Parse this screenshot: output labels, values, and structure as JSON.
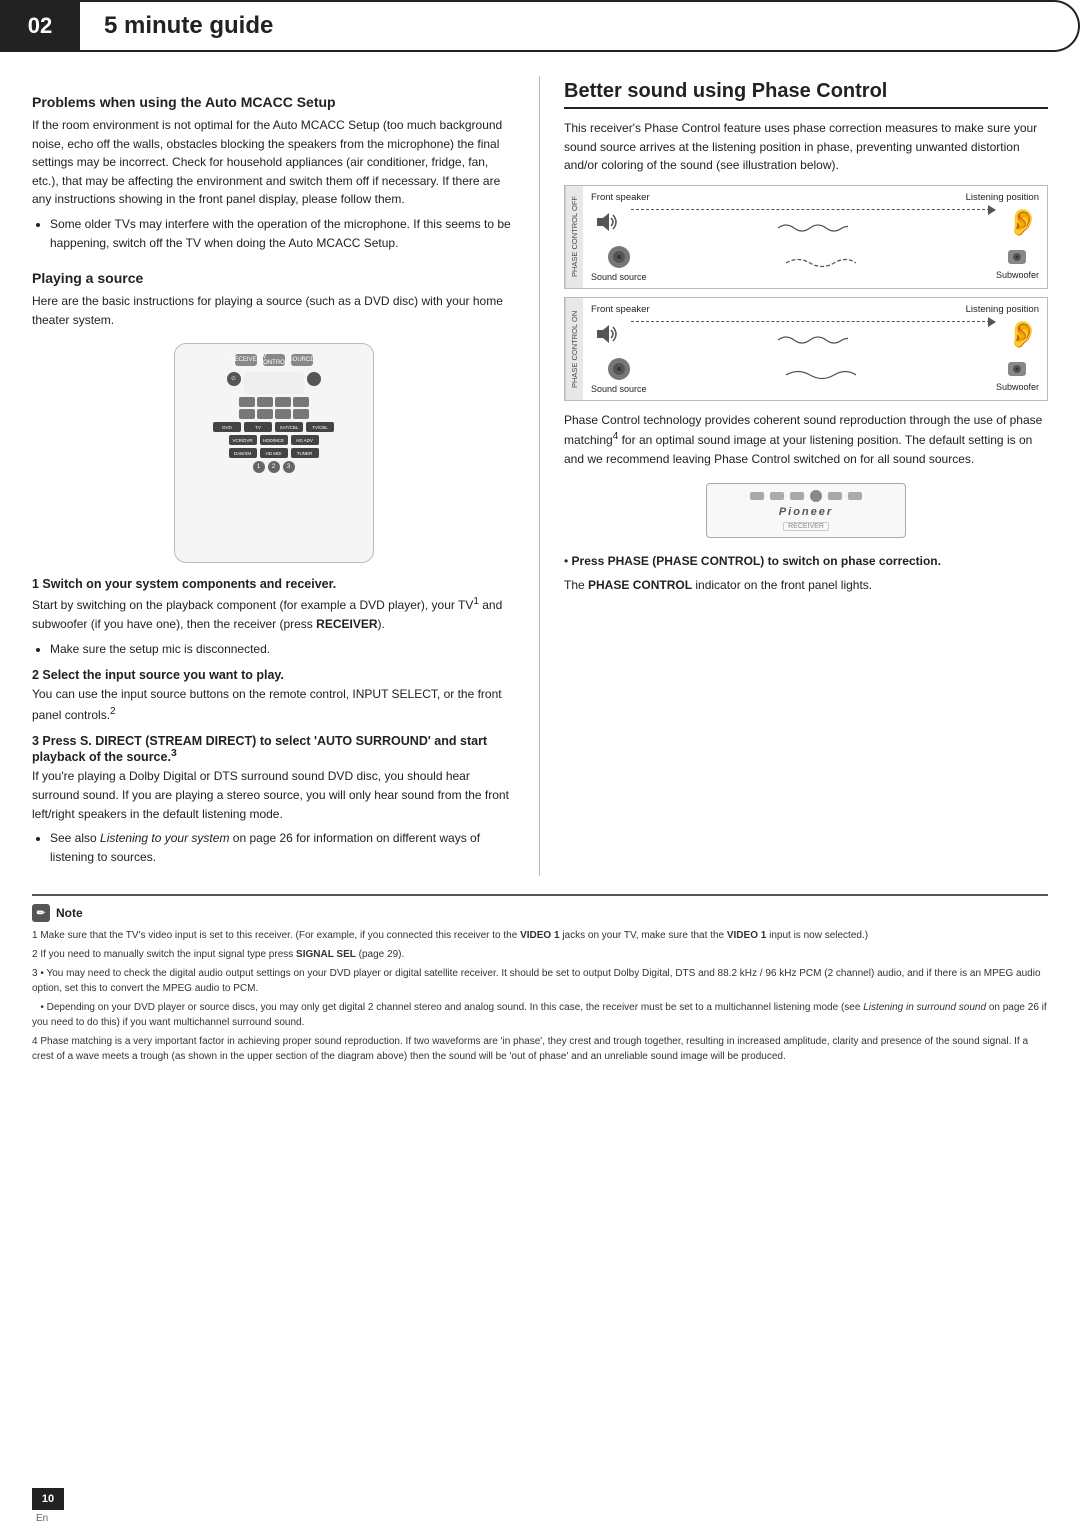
{
  "header": {
    "number": "02",
    "title": "5 minute guide"
  },
  "left_column": {
    "auto_mcacc_heading": "Problems when using the Auto MCACC Setup",
    "auto_mcacc_para1": "If the room environment is not optimal for the Auto MCACC Setup (too much background noise, echo off the walls, obstacles blocking the speakers from the microphone) the final settings may be incorrect. Check for household appliances (air conditioner, fridge, fan, etc.), that may be affecting the environment and switch them off if necessary. If there are any instructions showing in the front panel display, please follow them.",
    "auto_mcacc_bullet1": "Some older TVs may interfere with the operation of the microphone. If this seems to be happening, switch off the TV when doing the Auto MCACC Setup.",
    "playing_heading": "Playing a source",
    "playing_para": "Here are the basic instructions for playing a source (such as a DVD disc) with your home theater system.",
    "step1_title": "1   Switch on your system components and receiver.",
    "step1_para": "Start by switching on the playback component (for example a DVD player), your TV",
    "step1_super1": "1",
    "step1_para2": " and subwoofer (if you have one), then the receiver (press",
    "step1_receiver": " RECEIVER",
    "step1_para3": ").",
    "step1_bullet": "Make sure the setup mic is disconnected.",
    "step2_title": "2   Select the input source you want to play.",
    "step2_para": "You can use the input source buttons on the remote control, INPUT SELECT, or the front panel controls.",
    "step2_super": "2",
    "step3_title": "3   Press S. DIRECT (STREAM DIRECT) to select 'AUTO SURROUND' and start playback of the source.",
    "step3_super": "3",
    "step3_para": "If you're playing a Dolby Digital or DTS surround sound DVD disc, you should hear surround sound. If you are playing a stereo source, you will only hear sound from the front left/right speakers in the default listening mode.",
    "step3_bullet": "See also Listening to your system on page 26 for information on different ways of listening to sources."
  },
  "right_column": {
    "better_sound_heading": "Better sound using Phase Control",
    "better_sound_para1": "This receiver's Phase Control feature uses phase correction measures to make sure your sound source arrives at the listening position in phase, preventing unwanted distortion and/or coloring of the sound (see illustration below).",
    "diagram1_side_label": "PHASE CONTROL OFF",
    "diagram2_side_label": "PHASE CONTROL ON",
    "diagram_top_left1": "Front speaker",
    "diagram_top_right1": "Listening\nposition",
    "diagram_sound_source1": "Sound\nsource",
    "diagram_subwoofer1": "Subwoofer",
    "diagram_top_left2": "Front speaker",
    "diagram_top_right2": "Listening\nposition",
    "diagram_sound_source2": "Sound\nsource",
    "diagram_subwoofer2": "Subwoofer",
    "phase_para": "Phase Control technology provides coherent sound reproduction through the use of phase matching",
    "phase_super": "4",
    "phase_para2": " for an optimal sound image at your listening position. The default setting is on and we recommend leaving Phase Control switched on for all sound sources.",
    "press_phase_bold": "Press PHASE (PHASE CONTROL) to switch on phase correction.",
    "phase_indicator": "The PHASE CONTROL indicator on the front panel lights."
  },
  "notes": {
    "title": "Note",
    "notes_list": [
      "Make sure that the TV's video input is set to this receiver. (For example, if you connected this receiver to the VIDEO 1 jacks on your TV, make sure that the VIDEO 1 input is now selected.)",
      "If you need to manually switch the input signal type press SIGNAL SEL (page 29).",
      "You may need to check the digital audio output settings on your DVD player or digital satellite receiver. It should be set to output Dolby Digital, DTS and 88.2 kHz / 96 kHz PCM (2 channel) audio, and if there is an MPEG audio option, set this to convert the MPEG audio to PCM.",
      "Depending on your DVD player or source discs, you may only get digital 2 channel stereo and analog sound. In this case, the receiver must be set to a multichannel listening mode (see Listening in surround sound on page 26 if you need to do this) if you want multichannel surround sound.",
      "Phase matching is a very important factor in achieving proper sound reproduction. If two waveforms are 'in phase', they crest and trough together, resulting in increased amplitude, clarity and presence of the sound signal. If a crest of a wave meets a trough (as shown in the upper section of the diagram above) then the sound will be 'out of phase' and an unreliable sound image will be produced."
    ]
  },
  "page_number": "10",
  "page_lang": "En"
}
